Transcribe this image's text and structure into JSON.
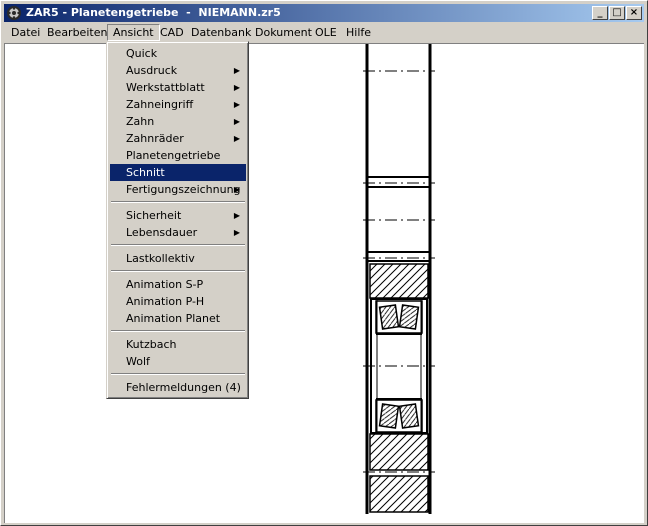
{
  "window": {
    "title": "ZAR5 - Planetengetriebe  -  NIEMANN.zr5",
    "controls": [
      "_",
      "□",
      "×"
    ]
  },
  "menubar": {
    "items": [
      "Datei",
      "Bearbeiten",
      "Ansicht",
      "CAD",
      "Datenbank",
      "Dokument",
      "OLE",
      "Hilfe"
    ],
    "open_item": "Ansicht"
  },
  "ansicht_menu": {
    "items": [
      {
        "label": "Quick",
        "submenu": false
      },
      {
        "label": "Ausdruck",
        "submenu": true
      },
      {
        "label": "Werkstattblatt",
        "submenu": true
      },
      {
        "label": "Zahneingriff",
        "submenu": true
      },
      {
        "label": "Zahn",
        "submenu": true
      },
      {
        "label": "Zahnräder",
        "submenu": true
      },
      {
        "label": "Planetengetriebe",
        "submenu": false
      },
      {
        "label": "Schnitt",
        "submenu": false,
        "selected": true
      },
      {
        "label": "Fertigungszeichnung",
        "submenu": true
      },
      {
        "label": "Sicherheit",
        "submenu": true
      },
      {
        "label": "Lebensdauer",
        "submenu": true
      },
      {
        "label": "Lastkollektiv",
        "submenu": false
      },
      {
        "label": "Animation S-P",
        "submenu": false
      },
      {
        "label": "Animation P-H",
        "submenu": false
      },
      {
        "label": "Animation Planet",
        "submenu": false
      },
      {
        "label": "Kutzbach",
        "submenu": false
      },
      {
        "label": "Wolf",
        "submenu": false
      },
      {
        "label": "Fehlermeldungen (4)",
        "submenu": false
      }
    ],
    "submenu_arrow": "▶"
  },
  "icons": {
    "app": "gear-icon",
    "minimize": "minimize-icon",
    "maximize": "maximize-icon",
    "close": "close-icon",
    "submenu": "submenu-arrow-icon"
  },
  "colors": {
    "titlebar_start": "#0a246a",
    "titlebar_end": "#a6caf0",
    "selection": "#0a246a",
    "face": "#d4d0c8"
  }
}
